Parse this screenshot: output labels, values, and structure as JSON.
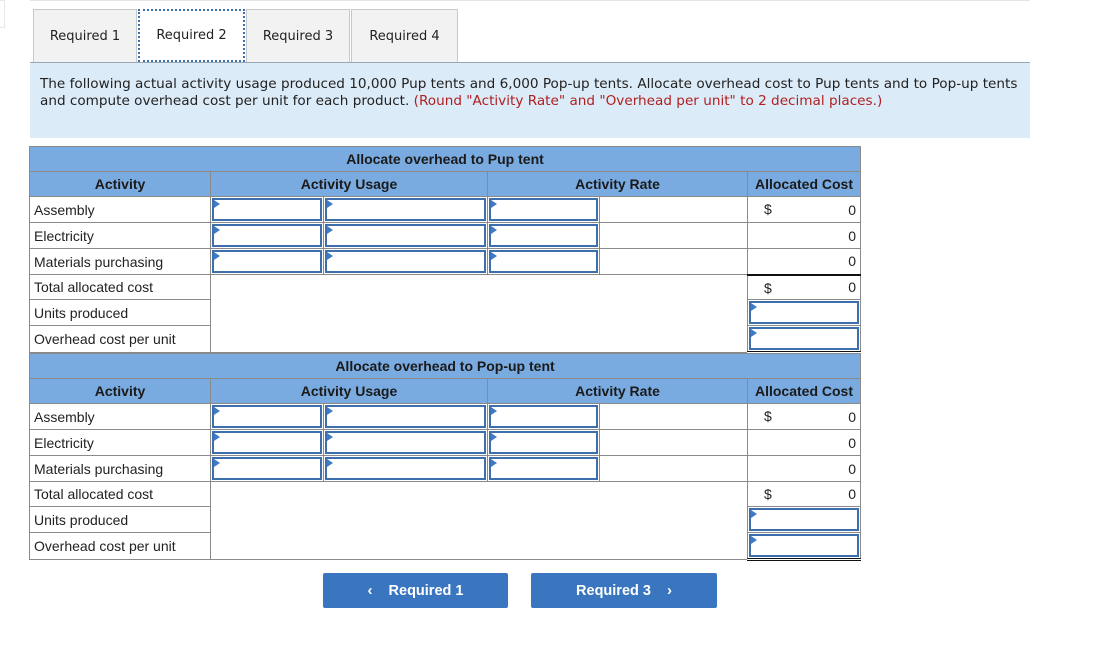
{
  "tabs": [
    {
      "label": "Required 1",
      "active": false
    },
    {
      "label": "Required 2",
      "active": true
    },
    {
      "label": "Required 3",
      "active": false
    },
    {
      "label": "Required 4",
      "active": false
    }
  ],
  "prompt": {
    "text": "The following actual activity usage produced 10,000 Pup tents and 6,000 Pop-up tents. Allocate overhead cost to Pup tents and to Pop-up tents and compute overhead cost per unit for each product. ",
    "instruction": "(Round \"Activity Rate\" and \"Overhead per unit\" to 2 decimal places.)"
  },
  "columns": {
    "activity": "Activity",
    "usage": "Activity Usage",
    "rate": "Activity Rate",
    "cost": "Allocated Cost"
  },
  "tables": [
    {
      "title": "Allocate overhead to Pup tent",
      "rows": [
        {
          "activity": "Assembly",
          "usage_a": "",
          "usage_b": "",
          "rate": "",
          "currency": "$",
          "cost": "0"
        },
        {
          "activity": "Electricity",
          "usage_a": "",
          "usage_b": "",
          "rate": "",
          "currency": "",
          "cost": "0"
        },
        {
          "activity": "Materials purchasing",
          "usage_a": "",
          "usage_b": "",
          "rate": "",
          "currency": "",
          "cost": "0"
        }
      ],
      "total": {
        "label": "Total allocated cost",
        "currency": "$",
        "value": "0"
      },
      "units": {
        "label": "Units produced",
        "value": ""
      },
      "per_unit": {
        "label": "Overhead cost per unit",
        "value": ""
      }
    },
    {
      "title": "Allocate overhead to Pop-up tent",
      "rows": [
        {
          "activity": "Assembly",
          "usage_a": "",
          "usage_b": "",
          "rate": "",
          "currency": "$",
          "cost": "0"
        },
        {
          "activity": "Electricity",
          "usage_a": "",
          "usage_b": "",
          "rate": "",
          "currency": "",
          "cost": "0"
        },
        {
          "activity": "Materials purchasing",
          "usage_a": "",
          "usage_b": "",
          "rate": "",
          "currency": "",
          "cost": "0"
        }
      ],
      "total": {
        "label": "Total allocated cost",
        "currency": "$",
        "value": "0"
      },
      "units": {
        "label": "Units produced",
        "value": ""
      },
      "per_unit": {
        "label": "Overhead cost per unit",
        "value": ""
      }
    }
  ],
  "nav": {
    "prev_label": "Required 1",
    "prev_icon": "‹",
    "next_label": "Required 3",
    "next_icon": "›"
  }
}
